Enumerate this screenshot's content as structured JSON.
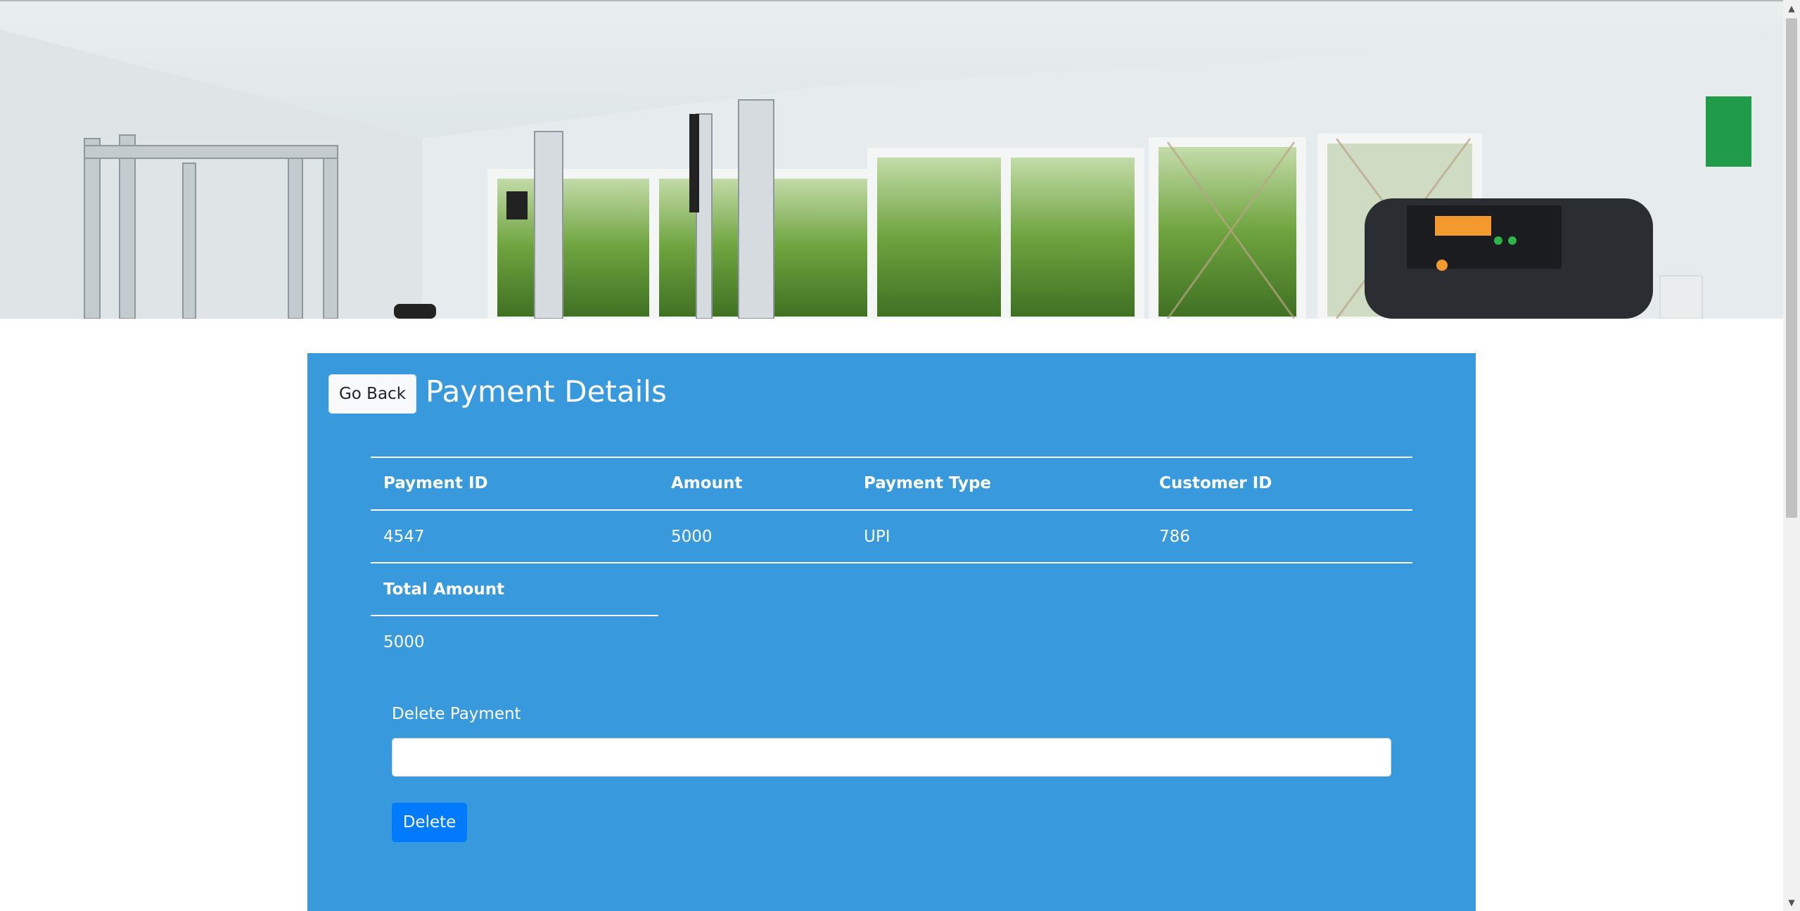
{
  "header": {
    "go_back_label": "Go Back",
    "title": "Payment Details"
  },
  "table": {
    "columns": [
      "Payment ID",
      "Amount",
      "Payment Type",
      "Customer ID"
    ],
    "rows": [
      [
        "4547",
        "5000",
        "UPI",
        "786"
      ]
    ],
    "total_label": "Total Amount",
    "total_value": "5000"
  },
  "delete_form": {
    "label": "Delete Payment",
    "input_value": "",
    "input_placeholder": "",
    "button_label": "Delete"
  },
  "colors": {
    "card_background": "#3899dc",
    "primary_button": "#007bff",
    "light_button": "#f8f9fa"
  },
  "icons": {
    "scroll_up": "scroll-up-arrow-icon",
    "scroll_down": "scroll-down-arrow-icon"
  }
}
